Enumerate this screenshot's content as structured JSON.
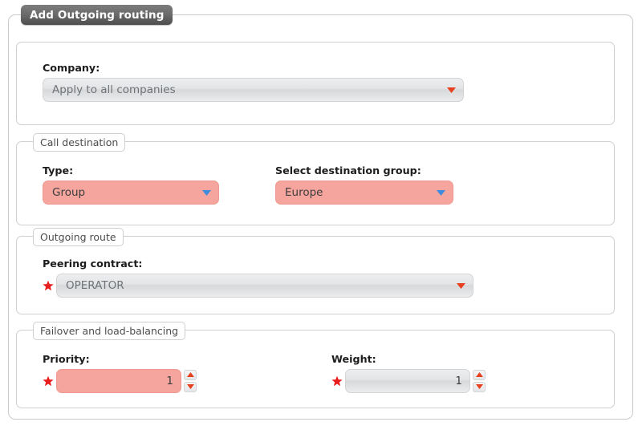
{
  "window": {
    "title": "Add Outgoing routing"
  },
  "colors": {
    "highlight_pink": "#f5a59d",
    "select_gray": "#e3e5e7",
    "arrow_red": "#e8401f",
    "arrow_blue": "#3f8bdd",
    "star_red": "#e81e1e",
    "tab_dark": "#6c6c6c"
  },
  "sections": {
    "company": {
      "legend": "",
      "field": {
        "label": "Company:",
        "value": "Apply to all companies",
        "arrow_icon": "triangle-down-icon",
        "required": false,
        "state": "normal"
      }
    },
    "call_destination": {
      "legend": "Call destination",
      "type": {
        "label": "Type:",
        "value": "Group",
        "arrow_icon": "triangle-down-icon",
        "required": false,
        "state": "highlighted"
      },
      "destination_group": {
        "label": "Select destination group:",
        "value": "Europe",
        "arrow_icon": "triangle-down-icon",
        "required": false,
        "state": "highlighted"
      }
    },
    "outgoing_route": {
      "legend": "Outgoing route",
      "peering_contract": {
        "label": "Peering contract:",
        "value": "OPERATOR",
        "arrow_icon": "triangle-down-icon",
        "required": true,
        "required_marker": "required-star-icon",
        "state": "normal"
      }
    },
    "failover": {
      "legend": "Failover and load-balancing",
      "priority": {
        "label": "Priority:",
        "value": "1",
        "required": true,
        "required_marker": "required-star-icon",
        "state": "highlighted",
        "spinner_up_icon": "triangle-up-icon",
        "spinner_down_icon": "triangle-down-icon"
      },
      "weight": {
        "label": "Weight:",
        "value": "1",
        "required": true,
        "required_marker": "required-star-icon",
        "state": "normal",
        "spinner_up_icon": "triangle-up-icon",
        "spinner_down_icon": "triangle-down-icon"
      }
    }
  }
}
